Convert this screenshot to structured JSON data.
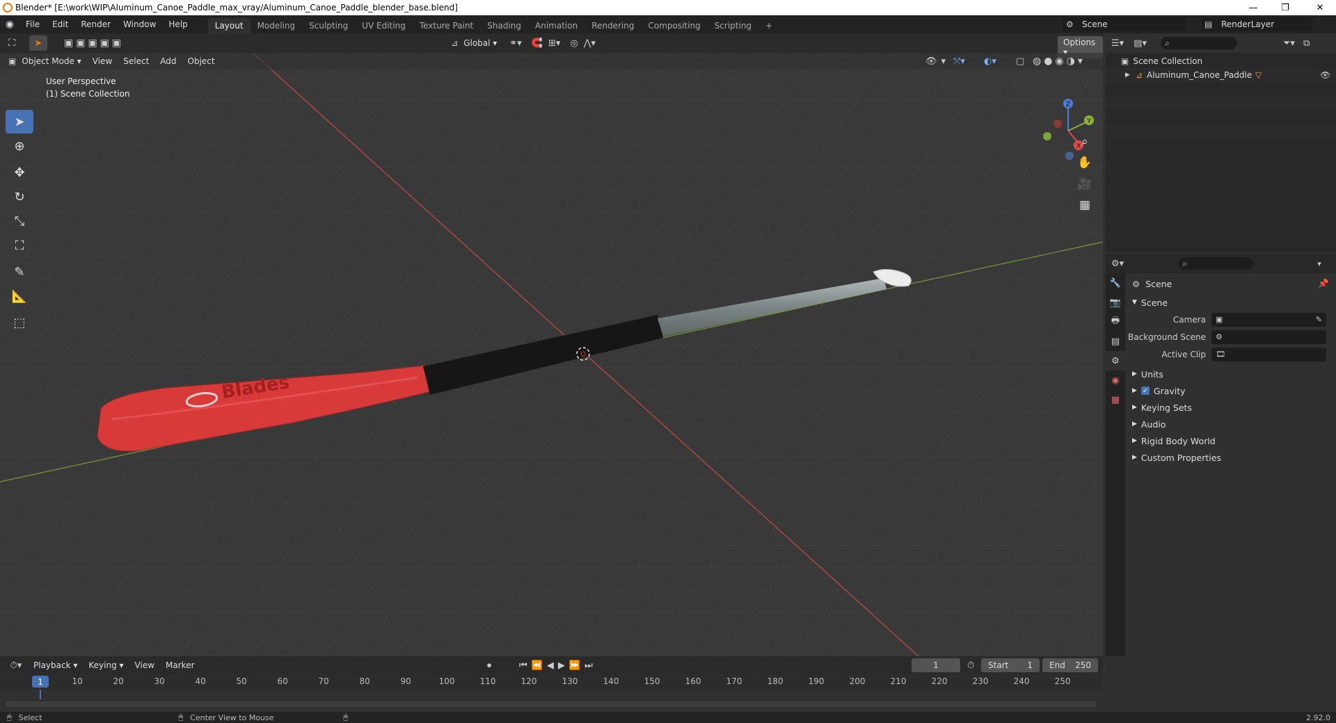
{
  "window": {
    "title": "Blender* [E:\\work\\WIP\\Aluminum_Canoe_Paddle_max_vray/Aluminum_Canoe_Paddle_blender_base.blend]",
    "minimize": "—",
    "maximize": "❐",
    "close": "✕"
  },
  "menu": {
    "items": [
      "File",
      "Edit",
      "Render",
      "Window",
      "Help"
    ],
    "workspaces": [
      "Layout",
      "Modeling",
      "Sculpting",
      "UV Editing",
      "Texture Paint",
      "Shading",
      "Animation",
      "Rendering",
      "Compositing",
      "Scripting"
    ],
    "add_workspace": "+",
    "scene": "Scene",
    "view_layer": "RenderLayer"
  },
  "viewport": {
    "transform_orientation": "Global",
    "options_label": "Options",
    "mode": "Object Mode",
    "header_menus": [
      "View",
      "Select",
      "Add",
      "Object"
    ],
    "overlay_line1": "User Perspective",
    "overlay_line2": "(1) Scene Collection",
    "gizmo": {
      "x": "X",
      "y": "Y",
      "z": "Z"
    },
    "paddle_text": "Blades"
  },
  "outliner": {
    "collection": "Scene Collection",
    "object": "Aluminum_Canoe_Paddle"
  },
  "properties": {
    "context": "Scene",
    "panel": "Scene",
    "fields": [
      {
        "label": "Camera"
      },
      {
        "label": "Background Scene"
      },
      {
        "label": "Active Clip"
      }
    ],
    "sections": [
      "Units",
      "Gravity",
      "Keying Sets",
      "Audio",
      "Rigid Body World",
      "Custom Properties"
    ],
    "gravity_checked": true
  },
  "timeline": {
    "menus": [
      "Playback",
      "Keying",
      "View",
      "Marker"
    ],
    "current_frame": "1",
    "start_label": "Start",
    "start": "1",
    "end_label": "End",
    "end": "250",
    "ticks": [
      "1",
      "10",
      "20",
      "30",
      "40",
      "50",
      "60",
      "70",
      "80",
      "90",
      "100",
      "110",
      "120",
      "130",
      "140",
      "150",
      "160",
      "170",
      "180",
      "190",
      "200",
      "210",
      "220",
      "230",
      "240",
      "250"
    ]
  },
  "status": {
    "left": "Select",
    "middle": "Center View to Mouse",
    "version": "2.92.0"
  },
  "colors": {
    "accent": "#4772b3",
    "paddle_blade": "#d83a3a",
    "x_axis": "#e04a4a",
    "y_axis": "#8ab13a"
  }
}
